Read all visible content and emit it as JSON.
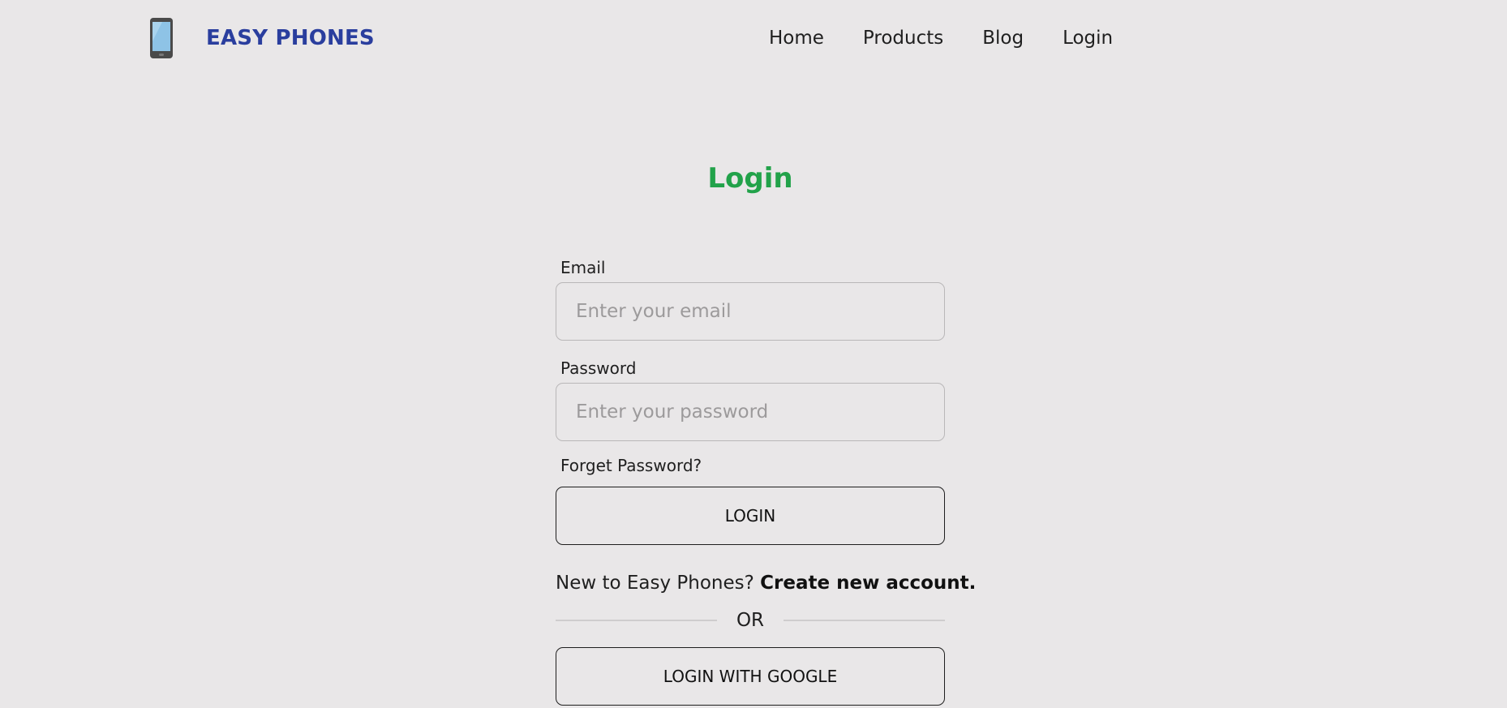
{
  "brand": {
    "name": "EASY PHONES",
    "logo_icon": "phone-icon"
  },
  "nav": {
    "items": [
      {
        "label": "Home"
      },
      {
        "label": "Products"
      },
      {
        "label": "Blog"
      },
      {
        "label": "Login"
      }
    ]
  },
  "page": {
    "title": "Login"
  },
  "form": {
    "email_label": "Email",
    "email_placeholder": "Enter your email",
    "email_value": "",
    "password_label": "Password",
    "password_placeholder": "Enter your password",
    "password_value": "",
    "forget_label": "Forget Password?",
    "login_button": "LOGIN",
    "signup_prompt": "New to Easy Phones? ",
    "signup_link": "Create new account.",
    "divider_text": "OR",
    "google_button": "LOGIN WITH GOOGLE"
  },
  "colors": {
    "background": "#e9e7e8",
    "brand": "#2a3e9e",
    "title": "#22a24a"
  }
}
